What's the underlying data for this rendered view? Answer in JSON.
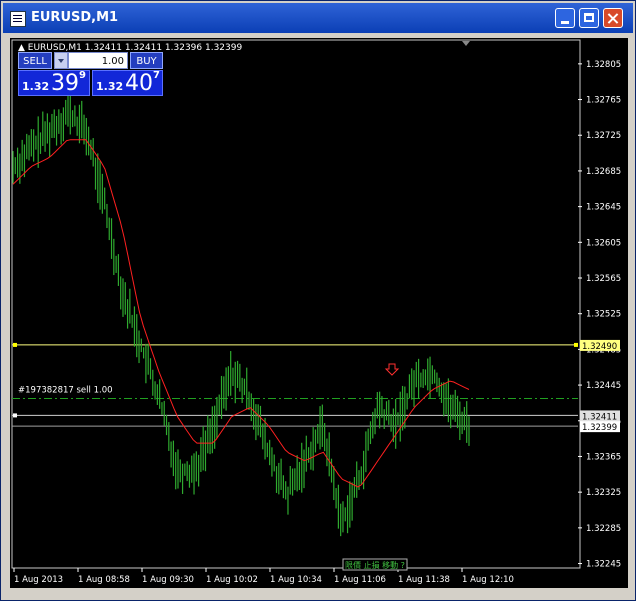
{
  "window": {
    "title": "EURUSD,M1"
  },
  "chart_header": {
    "symbol_line": "▲ EURUSD,M1  1.32411 1.32411 1.32396 1.32399"
  },
  "trade_panel": {
    "sell_label": "SELL",
    "buy_label": "BUY",
    "lot_value": "1.00",
    "sell_price": {
      "small": "1.32",
      "big": "39",
      "pip": "9"
    },
    "buy_price": {
      "small": "1.32",
      "big": "40",
      "pip": "7"
    }
  },
  "order_label": "#197382817 sell 1.00",
  "bottom_box_label": "限價 止損 移動 ?",
  "colors": {
    "background": "#000000",
    "candles": "#2faa2f",
    "ma": "#ff2020",
    "order_line": "#20a020",
    "level_yellow": "#ffff80",
    "axis_text": "#ffffff"
  },
  "price_axis": {
    "ticks": [
      "1.32805",
      "1.32765",
      "1.32725",
      "1.32685",
      "1.32645",
      "1.32605",
      "1.32565",
      "1.32525",
      "1.32485",
      "1.32445",
      "1.32405",
      "1.32365",
      "1.32325",
      "1.32285",
      "1.32245"
    ],
    "tag_yellow": "1.32490",
    "tag_bid": "1.32411",
    "tag_ask": "1.32399"
  },
  "time_axis": {
    "labels": [
      "1 Aug 2013",
      "1 Aug 08:58",
      "1 Aug 09:30",
      "1 Aug 10:02",
      "1 Aug 10:34",
      "1 Aug 11:06",
      "1 Aug 11:38",
      "1 Aug 12:10"
    ]
  },
  "chart_data": {
    "type": "line",
    "title": "EURUSD,M1",
    "xlabel": "",
    "ylabel": "",
    "ylim": [
      1.3224,
      1.32825
    ],
    "levels": {
      "yellow": 1.3249,
      "order": 1.3243,
      "bid": 1.32411,
      "ask": 1.32399
    },
    "x": [
      "1 Aug 2013",
      "1 Aug 08:58",
      "1 Aug 09:30",
      "1 Aug 10:02",
      "1 Aug 10:34",
      "1 Aug 11:06",
      "1 Aug 11:38",
      "1 Aug 12:10"
    ],
    "series": [
      {
        "values": [
          1.3269,
          1.3271,
          1.3273,
          1.3275,
          1.3273,
          1.3265,
          1.3255,
          1.3249,
          1.3243,
          1.3235,
          1.3235,
          1.324,
          1.3246,
          1.3243,
          1.3237,
          1.3232,
          1.3236,
          1.324,
          1.3229,
          1.3234,
          1.3242,
          1.324,
          1.3245,
          1.3246,
          1.3242,
          1.324
        ]
      },
      {
        "values": [
          1.3267,
          1.3269,
          1.327,
          1.3272,
          1.3272,
          1.3269,
          1.3262,
          1.3252,
          1.3246,
          1.3241,
          1.3238,
          1.3238,
          1.3241,
          1.3242,
          1.324,
          1.3237,
          1.3236,
          1.3237,
          1.3234,
          1.3233,
          1.3236,
          1.3239,
          1.3242,
          1.3244,
          1.3245,
          1.3244
        ]
      }
    ]
  }
}
